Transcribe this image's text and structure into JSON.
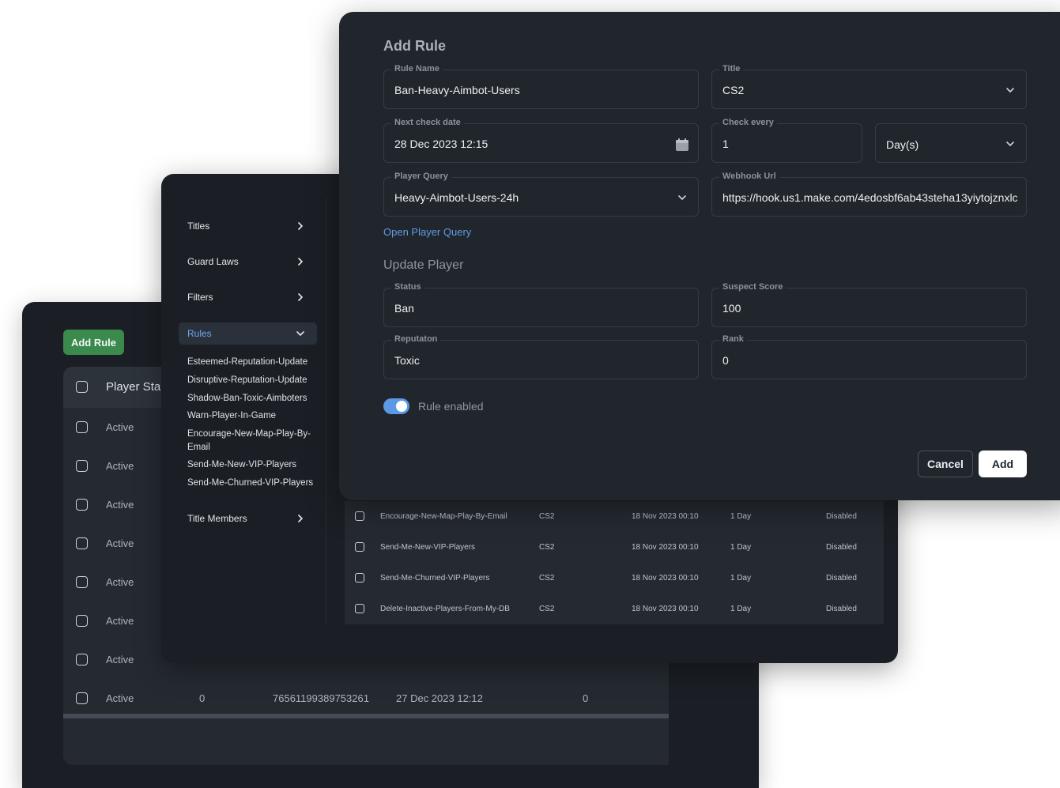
{
  "back_panel": {
    "add_rule_label": "Add Rule",
    "header_label": "Player Sta",
    "rows": [
      {
        "status": "Active"
      },
      {
        "status": "Active"
      },
      {
        "status": "Active"
      },
      {
        "status": "Active"
      },
      {
        "status": "Active"
      },
      {
        "status": "Active"
      },
      {
        "status": "Active"
      },
      {
        "status": "Active",
        "score": "0",
        "id": "76561199389753261",
        "date": "27 Dec 2023 12:12",
        "count": "0"
      }
    ]
  },
  "sidebar": {
    "items": [
      {
        "label": "Titles"
      },
      {
        "label": "Guard Laws"
      },
      {
        "label": "Filters"
      },
      {
        "label": "Rules"
      }
    ],
    "rules_children": [
      "Esteemed-Reputation-Update",
      "Disruptive-Reputation-Update",
      "Shadow-Ban-Toxic-Aimboters",
      "Warn-Player-In-Game",
      "Encourage-New-Map-Play-By-Email",
      "Send-Me-New-VIP-Players",
      "Send-Me-Churned-VIP-Players"
    ],
    "title_members_label": "Title Members"
  },
  "rules_table": {
    "rows": [
      {
        "name": "Encourage-New-Map-Play-By-Email",
        "title": "CS2",
        "next_check": "18 Nov 2023 00:10",
        "interval": "1 Day",
        "state": "Disabled"
      },
      {
        "name": "Send-Me-New-VIP-Players",
        "title": "CS2",
        "next_check": "18 Nov 2023 00:10",
        "interval": "1 Day",
        "state": "Disabled"
      },
      {
        "name": "Send-Me-Churned-VIP-Players",
        "title": "CS2",
        "next_check": "18 Nov 2023 00:10",
        "interval": "1 Day",
        "state": "Disabled"
      },
      {
        "name": "Delete-Inactive-Players-From-My-DB",
        "title": "CS2",
        "next_check": "18 Nov 2023 00:10",
        "interval": "1 Day",
        "state": "Disabled"
      }
    ]
  },
  "dialog": {
    "title": "Add Rule",
    "rule_name": {
      "label": "Rule Name",
      "value": "Ban-Heavy-Aimbot-Users"
    },
    "title_field": {
      "label": "Title",
      "value": "CS2"
    },
    "next_check_date": {
      "label": "Next check date",
      "value": "28 Dec 2023 12:15"
    },
    "check_every": {
      "label": "Check every",
      "value": "1"
    },
    "check_unit": {
      "value": "Day(s)"
    },
    "player_query": {
      "label": "Player Query",
      "value": "Heavy-Aimbot-Users-24h"
    },
    "webhook_url": {
      "label": "Webhook Url",
      "value": "https://hook.us1.make.com/4edosbf6ab43steha13yiytojznxlc"
    },
    "open_query_link": "Open Player Query",
    "update_player_heading": "Update Player",
    "status": {
      "label": "Status",
      "value": "Ban"
    },
    "suspect_score": {
      "label": "Suspect Score",
      "value": "100"
    },
    "reputation": {
      "label": "Reputaton",
      "value": "Toxic"
    },
    "rank": {
      "label": "Rank",
      "value": "0"
    },
    "rule_enabled_label": "Rule enabled",
    "rule_enabled": true,
    "cancel_label": "Cancel",
    "add_label": "Add"
  },
  "colors": {
    "accent": "#5b99e6",
    "success": "#3a8a4e",
    "panel": "#1b1f25",
    "dialog": "#21262d"
  },
  "icons": [
    "chevron-right-icon",
    "chevron-down-icon",
    "calendar-icon",
    "checkbox-icon"
  ]
}
